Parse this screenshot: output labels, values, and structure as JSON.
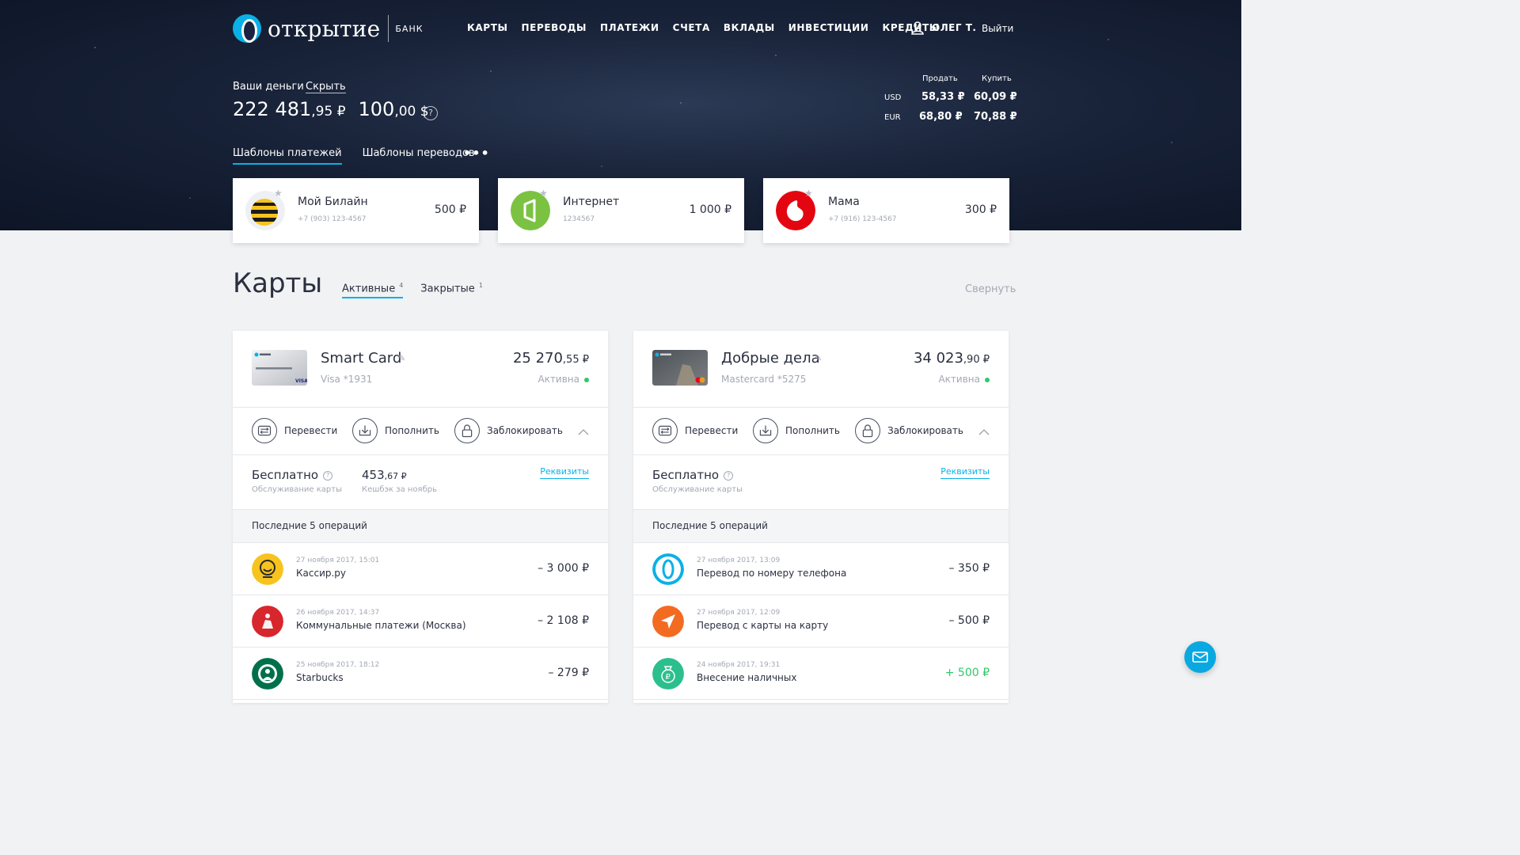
{
  "header": {
    "logo_text": "открытие",
    "logo_bank": "БАНК",
    "nav": [
      "КАРТЫ",
      "ПЕРЕВОДЫ",
      "ПЛАТЕЖИ",
      "СЧЕТА",
      "ВКЛАДЫ",
      "ИНВЕСТИЦИИ",
      "КРЕДИТЫ"
    ],
    "user_name": "ОЛЕГ Т.",
    "logout": "Выйти"
  },
  "money": {
    "label": "Ваши деньги",
    "hide": "Скрыть",
    "rub_int": "222 481",
    "rub_dec": ",95 ₽",
    "usd_int": "100",
    "usd_dec": ",00 $",
    "help": "?"
  },
  "rates": {
    "sell_label": "Продать",
    "buy_label": "Купить",
    "rows": [
      {
        "cur": "USD",
        "sell": "58,33 ₽",
        "buy": "60,09 ₽"
      },
      {
        "cur": "EUR",
        "sell": "68,80 ₽",
        "buy": "70,88 ₽"
      }
    ]
  },
  "templates": {
    "tabs": [
      "Шаблоны платежей",
      "Шаблоны переводов"
    ],
    "more": "•••",
    "items": [
      {
        "title": "Мой Билайн",
        "sub": "+7 (903) 123-4567",
        "amount": "500 ₽",
        "icon": "beeline-icon"
      },
      {
        "title": "Интернет",
        "sub": "1234567",
        "amount": "1 000 ₽",
        "icon": "internet-provider-icon"
      },
      {
        "title": "Мама",
        "sub": "+7 (916) 123-4567",
        "amount": "300 ₽",
        "icon": "mts-icon"
      }
    ]
  },
  "cards_section": {
    "title": "Карты",
    "tab_active": "Активные",
    "tab_active_count": "4",
    "tab_closed": "Закрытые",
    "tab_closed_count": "1",
    "collapse": "Свернуть"
  },
  "cards": [
    {
      "name": "Smart Card",
      "number": "Visa *1931",
      "balance_int": "25 270",
      "balance_dec": ",55 ₽",
      "status": "Активна",
      "actions": [
        "Перевести",
        "Пополнить",
        "Заблокировать"
      ],
      "service": "Бесплатно",
      "service_sub": "Обслуживание карты",
      "cashback_int": "453",
      "cashback_dec": ",67 ₽",
      "cashback_sub": "Кешбэк за ноябрь",
      "requisites": "Реквизиты",
      "ops_title": "Последние 5 операций",
      "ops": [
        {
          "date": "27 ноября 2017, 15:01",
          "name": "Кассир.ру",
          "amount": "– 3 000 ₽",
          "icon": "kassir-icon",
          "color": "#f7c31f"
        },
        {
          "date": "26 ноября 2017, 14:37",
          "name": "Коммунальные платежи (Москва)",
          "amount": "– 2 108 ₽",
          "icon": "moscow-coat-icon",
          "color": "#d8262d"
        },
        {
          "date": "25 ноября 2017, 18:12",
          "name": "Starbucks",
          "amount": "– 279 ₽",
          "icon": "starbucks-icon",
          "color": "#00704a"
        }
      ]
    },
    {
      "name": "Добрые дела",
      "number": "Mastercard *5275",
      "balance_int": "34 023",
      "balance_dec": ",90 ₽",
      "status": "Активна",
      "actions": [
        "Перевести",
        "Пополнить",
        "Заблокировать"
      ],
      "service": "Бесплатно",
      "service_sub": "Обслуживание карты",
      "requisites": "Реквизиты",
      "ops_title": "Последние 5 операций",
      "ops": [
        {
          "date": "27 ноября 2017, 13:09",
          "name": "Перевод по номеру телефона",
          "amount": "– 350 ₽",
          "icon": "otkritie-icon",
          "color": "#09b1e6"
        },
        {
          "date": "27 ноября 2017, 12:09",
          "name": "Перевод с карты на карту",
          "amount": "– 500 ₽",
          "icon": "send-arrow-icon",
          "color": "#f26b21"
        },
        {
          "date": "24 ноября 2017, 19:31",
          "name": "Внесение наличных",
          "amount": "+ 500 ₽",
          "icon": "cash-bag-icon",
          "color": "#2bbf8e"
        }
      ]
    }
  ],
  "colors": {
    "accent": "#09b1e6",
    "positive": "#31c76a"
  }
}
